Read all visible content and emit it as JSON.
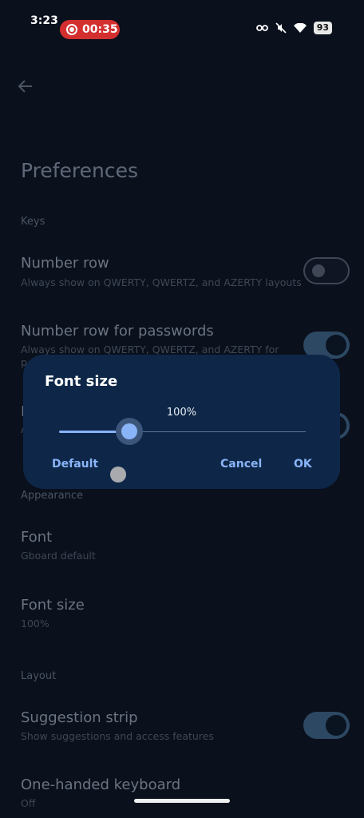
{
  "status_bar": {
    "time": "3:23",
    "recording": "00:35",
    "battery": "93"
  },
  "header": {
    "back_icon": "arrow-left-icon",
    "title": "Preferences"
  },
  "sections": {
    "keys": "Keys",
    "appearance": "Appearance",
    "layout": "Layout"
  },
  "items": {
    "number_row": {
      "title": "Number row",
      "subtitle": "Always show on QWERTY, QWERTZ, and AZERTY layouts",
      "enabled": false
    },
    "number_row_passwords": {
      "title": "Number row for passwords",
      "subtitle": "Always show on QWERTY, QWERTZ, and AZERTY for",
      "subtitle_line2": "p",
      "enabled": true
    },
    "hidden_item": {
      "title": "I",
      "subtitle": "A",
      "enabled": true
    },
    "font": {
      "title": "Font",
      "subtitle": "Gboard default"
    },
    "font_size": {
      "title": "Font size",
      "subtitle": "100%"
    },
    "suggestion_strip": {
      "title": "Suggestion strip",
      "subtitle": "Show suggestions and access features",
      "enabled": true
    },
    "one_handed": {
      "title": "One-handed keyboard",
      "subtitle": "Off"
    }
  },
  "dialog": {
    "title": "Font size",
    "value_label": "100%",
    "slider_fraction": 0.29,
    "buttons": {
      "default": "Default",
      "cancel": "Cancel",
      "ok": "OK"
    }
  },
  "colors": {
    "accent": "#8ab4f8",
    "dialog_bg": "#0e2748",
    "background": "#0a101c",
    "record": "#d32f2f"
  }
}
